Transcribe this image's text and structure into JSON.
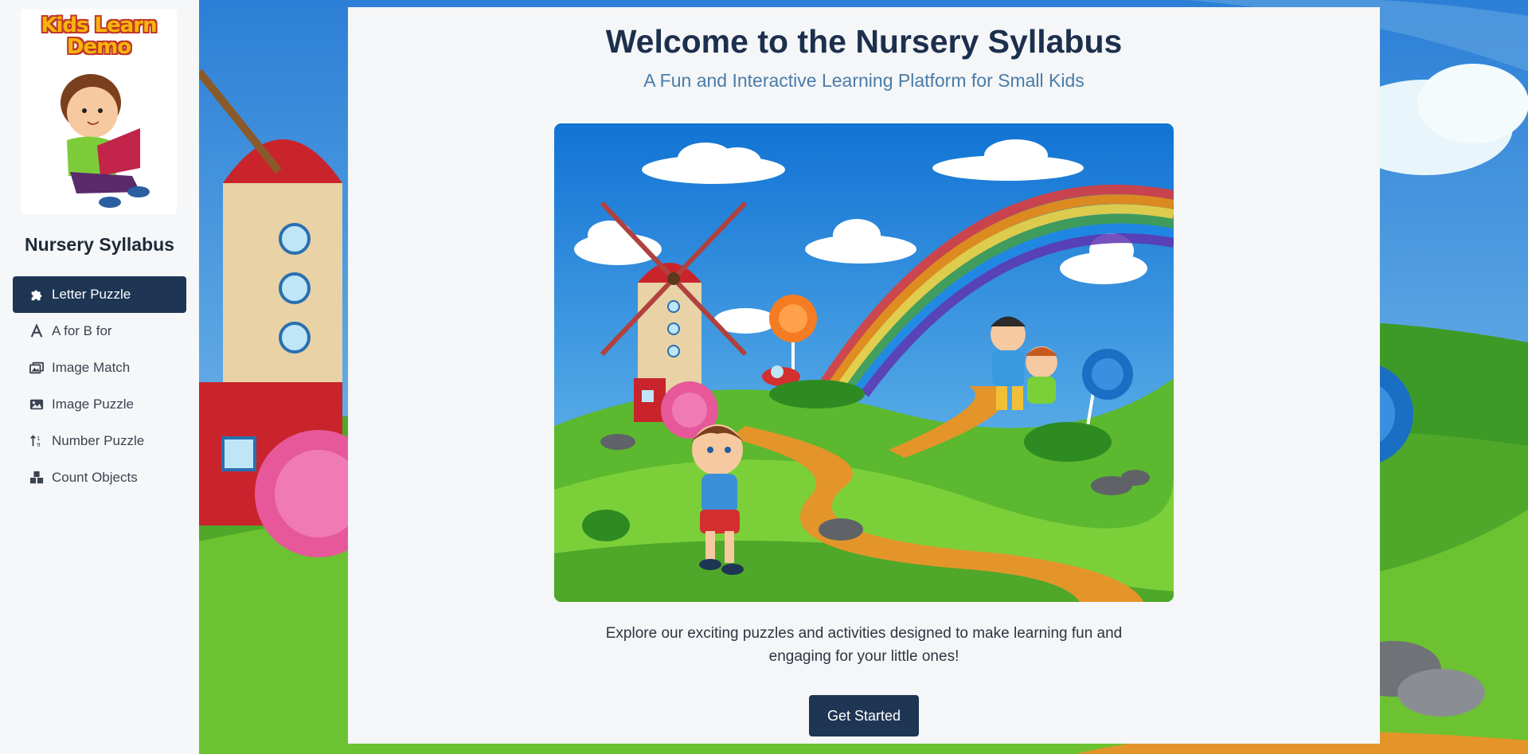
{
  "sidebar": {
    "logo_text": "Kids Learn Demo",
    "heading": "Nursery Syllabus",
    "items": [
      {
        "label": "Letter Puzzle",
        "icon": "puzzle-icon",
        "active": true
      },
      {
        "label": "A for B for",
        "icon": "letter-a-icon",
        "active": false
      },
      {
        "label": "Image Match",
        "icon": "images-icon",
        "active": false
      },
      {
        "label": "Image Puzzle",
        "icon": "image-icon",
        "active": false
      },
      {
        "label": "Number Puzzle",
        "icon": "sort-numeric-icon",
        "active": false
      },
      {
        "label": "Count Objects",
        "icon": "cubes-icon",
        "active": false
      }
    ]
  },
  "main": {
    "title": "Welcome to the Nursery Syllabus",
    "subtitle": "A Fun and Interactive Learning Platform for Small Kids",
    "description": "Explore our exciting puzzles and activities designed to make learning fun and engaging for your little ones!",
    "cta_label": "Get Started"
  },
  "colors": {
    "accent": "#1e3553",
    "title": "#1c2f4d",
    "subtitle": "#4a7ca8",
    "sidebar_bg": "#f6f7f9"
  }
}
